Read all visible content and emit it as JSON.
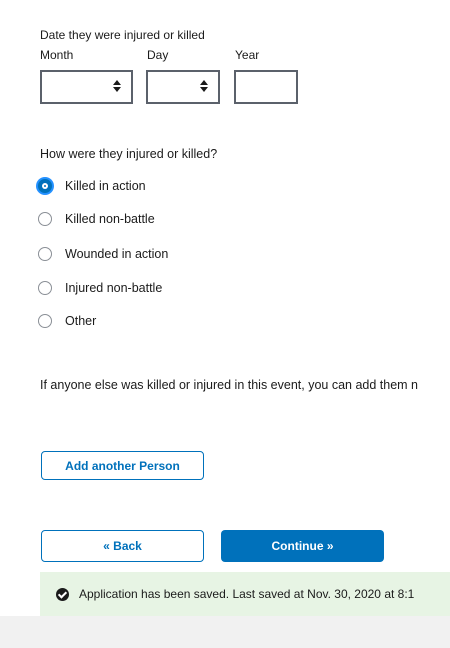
{
  "date_section": {
    "label": "Date they were injured or killed",
    "month_label": "Month",
    "day_label": "Day",
    "year_label": "Year",
    "month_value": "",
    "day_value": "",
    "year_value": ""
  },
  "how_section": {
    "question": "How were they injured or killed?",
    "options": [
      {
        "label": "Killed in action",
        "checked": true
      },
      {
        "label": "Killed non-battle",
        "checked": false
      },
      {
        "label": "Wounded in action",
        "checked": false
      },
      {
        "label": "Injured non-battle",
        "checked": false
      },
      {
        "label": "Other",
        "checked": false
      }
    ]
  },
  "info_text": "If anyone else was killed or injured in this event, you can add them n",
  "buttons": {
    "add_person": "Add another Person",
    "back": "« Back",
    "continue": "Continue »"
  },
  "save_status": {
    "message": "Application has been saved. Last saved at Nov. 30, 2020 at 8:1"
  },
  "colors": {
    "primary": "#0071bb",
    "saved_bg": "#e7f4e4"
  }
}
